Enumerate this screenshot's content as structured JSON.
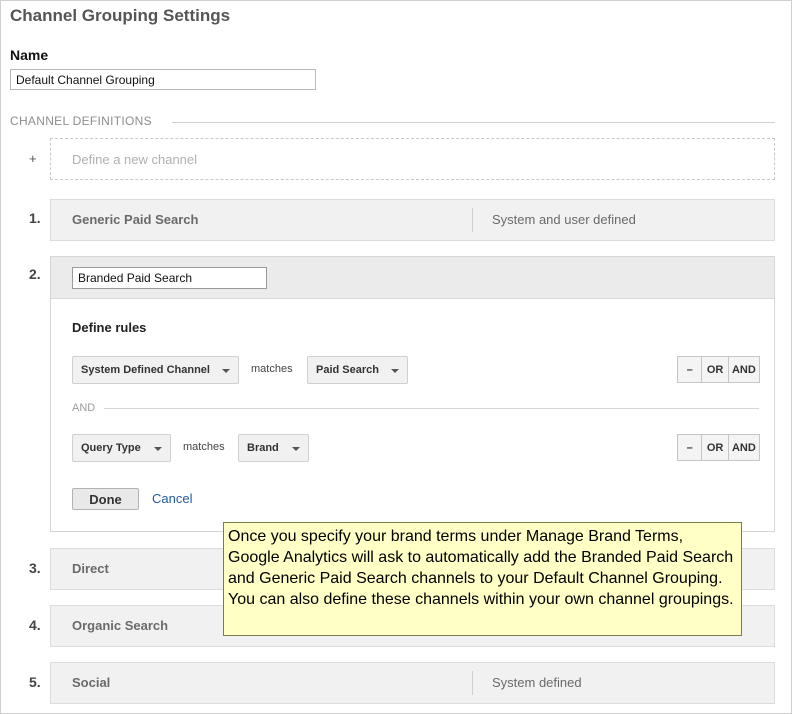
{
  "page": {
    "title": "Channel Grouping Settings"
  },
  "name_field": {
    "label": "Name",
    "value": "Default Channel Grouping"
  },
  "definitions": {
    "header": "CHANNEL DEFINITIONS",
    "new_channel_plus": "+",
    "new_channel_label": "Define a new channel"
  },
  "channels": [
    {
      "number": "1.",
      "name": "Generic Paid Search",
      "type": "System and user defined"
    },
    {
      "number": "2.",
      "name": "Branded Paid Search"
    },
    {
      "number": "3.",
      "name": "Direct"
    },
    {
      "number": "4.",
      "name": "Organic Search"
    },
    {
      "number": "5.",
      "name": "Social",
      "type": "System defined"
    }
  ],
  "editor": {
    "name_value": "Branded Paid Search",
    "define_rules_label": "Define rules",
    "rules": [
      {
        "dimension": "System Defined Channel",
        "operator": "matches",
        "value": "Paid Search"
      },
      {
        "dimension": "Query Type",
        "operator": "matches",
        "value": "Brand"
      }
    ],
    "rule_buttons": {
      "remove": "–",
      "or": "OR",
      "and": "AND"
    },
    "and_separator": "AND",
    "done_label": "Done",
    "cancel_label": "Cancel"
  },
  "callout": {
    "text": "Once you specify your brand terms under Manage Brand Terms, Google Analytics will ask to automatically add the Branded Paid Search and Generic Paid Search channels to your Default Channel Grouping. You can also define these channels within your own channel groupings."
  },
  "colors": {
    "callout_bg": "#ffffc6",
    "link": "#1f5a9e",
    "row_bg": "#f1f1f1"
  }
}
